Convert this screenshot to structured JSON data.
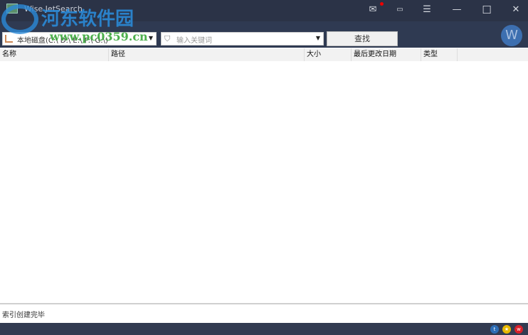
{
  "window": {
    "title": "Wise JetSearch",
    "buttons": {
      "mail": "✉",
      "feedback": "▭",
      "menu": "☰",
      "minimize": "—",
      "maximize": "☐",
      "close": "✕"
    }
  },
  "toolbar": {
    "drive_value": "本地磁盘(C:\\ D:\\ E:\\ F:\\ G:\\)",
    "keyword_placeholder": "输入关键词",
    "search_label": "查找",
    "avatar_letter": "W"
  },
  "columns": [
    "名称",
    "路径",
    "大小",
    "最后更改日期",
    "类型"
  ],
  "status": "索引创建完毕",
  "bottom_icons": [
    "twitter",
    "star",
    "weibo"
  ],
  "watermark": {
    "name": "河东软件园",
    "url": "www.pc0359.cn"
  }
}
